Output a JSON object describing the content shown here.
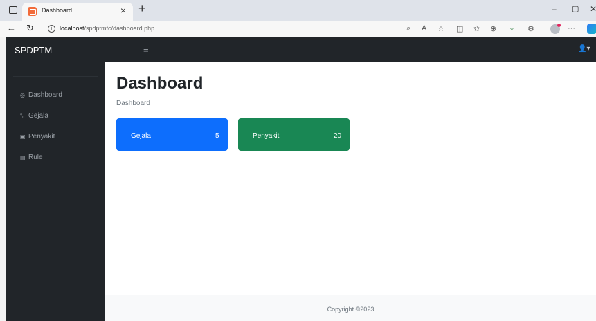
{
  "browser": {
    "tab_title": "Dashboard",
    "url_host": "localhost",
    "url_path": "/spdptmfc/dashboard.php",
    "new_tab": "+",
    "tab_close": "×",
    "minimize": "–",
    "restore": "▢",
    "close": "✕"
  },
  "app": {
    "brand": "SPDPTM",
    "toggle": "≡",
    "user_menu": "👤▾"
  },
  "sidebar": {
    "items": [
      {
        "label": "Dashboard",
        "icon": "◎"
      },
      {
        "label": "Gejala",
        "icon": "°ₒ"
      },
      {
        "label": "Penyakit",
        "icon": "▣"
      },
      {
        "label": "Rule",
        "icon": "▤"
      }
    ]
  },
  "main": {
    "title": "Dashboard",
    "breadcrumb": "Dashboard",
    "cards": [
      {
        "label": "Gejala",
        "count": "5",
        "color": "#0d6efd"
      },
      {
        "label": "Penyakit",
        "count": "20",
        "color": "#198754"
      }
    ]
  },
  "footer": {
    "copyright": "Copyright ©2023"
  }
}
